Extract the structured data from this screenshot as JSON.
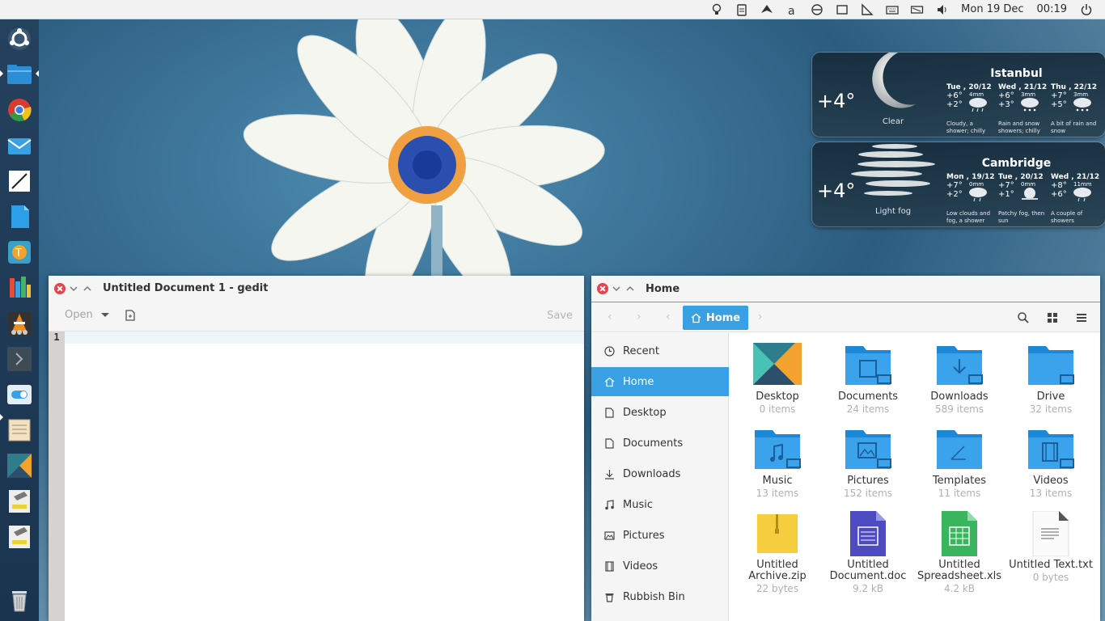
{
  "top_panel": {
    "date": "Mon 19 Dec",
    "time": "00:19",
    "icons": [
      "lightbulb-icon",
      "clipboard-icon",
      "bird-icon",
      "a-accent-icon",
      "no-entry-icon",
      "bracket-icon",
      "ruler-icon",
      "keyboard-icon",
      "battery-icon",
      "volume-icon",
      "power-icon"
    ]
  },
  "launcher": {
    "items": [
      "ubuntu-dash-icon",
      "files-icon",
      "chrome-icon",
      "mail-icon",
      "text-editor-icon",
      "document-icon",
      "tool-icon",
      "spreadsheet-app-icon",
      "vlc-icon",
      "terminal-icon",
      "toggle-app-icon",
      "notes-icon",
      "kde-icon",
      "installer-icon",
      "installer-2-icon",
      "trash-icon"
    ]
  },
  "weather": [
    {
      "temp": "+4°",
      "condition": "Clear",
      "city": "Istanbul",
      "days": [
        {
          "name": "Tue , 20/12",
          "hi": "+6°",
          "lo": "+2°",
          "mm": "4mm",
          "desc": "Cloudy, a shower; chilly"
        },
        {
          "name": "Wed , 21/12",
          "hi": "+6°",
          "lo": "+3°",
          "mm": "3mm",
          "desc": "Rain and snow showers; chilly"
        },
        {
          "name": "Thu , 22/12",
          "hi": "+7°",
          "lo": "+5°",
          "mm": "3mm",
          "desc": "A bit of rain and snow"
        }
      ]
    },
    {
      "temp": "+4°",
      "condition": "Light fog",
      "city": "Cambridge",
      "days": [
        {
          "name": "Mon , 19/12",
          "hi": "+7°",
          "lo": "+2°",
          "mm": "0mm",
          "desc": "Low clouds and fog, a shower"
        },
        {
          "name": "Tue , 20/12",
          "hi": "+7°",
          "lo": "+1°",
          "mm": "0mm",
          "desc": "Patchy fog, then sun"
        },
        {
          "name": "Wed , 21/12",
          "hi": "+8°",
          "lo": "+6°",
          "mm": "11mm",
          "desc": "A couple of showers"
        }
      ]
    }
  ],
  "gedit": {
    "title": "Untitled Document 1 - gedit",
    "open_label": "Open",
    "save_label": "Save",
    "line_number": "1"
  },
  "files": {
    "title": "Home",
    "path_label": "Home",
    "sidebar": [
      {
        "label": "Recent",
        "icon": "clock-icon"
      },
      {
        "label": "Home",
        "icon": "home-icon",
        "active": true
      },
      {
        "label": "Desktop",
        "icon": "desktop-icon"
      },
      {
        "label": "Documents",
        "icon": "document-icon"
      },
      {
        "label": "Downloads",
        "icon": "download-icon"
      },
      {
        "label": "Music",
        "icon": "music-icon"
      },
      {
        "label": "Pictures",
        "icon": "picture-icon"
      },
      {
        "label": "Videos",
        "icon": "video-icon"
      },
      {
        "label": "Rubbish Bin",
        "icon": "trash-icon"
      }
    ],
    "items": [
      {
        "name": "Desktop",
        "meta": "0 items",
        "icon": "desktop-folder-icon"
      },
      {
        "name": "Documents",
        "meta": "24 items",
        "icon": "documents-folder-icon"
      },
      {
        "name": "Downloads",
        "meta": "589 items",
        "icon": "downloads-folder-icon"
      },
      {
        "name": "Drive",
        "meta": "32 items",
        "icon": "drive-folder-icon"
      },
      {
        "name": "Music",
        "meta": "13 items",
        "icon": "music-folder-icon"
      },
      {
        "name": "Pictures",
        "meta": "152 items",
        "icon": "pictures-folder-icon"
      },
      {
        "name": "Templates",
        "meta": "11 items",
        "icon": "templates-folder-icon"
      },
      {
        "name": "Videos",
        "meta": "13 items",
        "icon": "videos-folder-icon"
      },
      {
        "name": "Untitled Archive.zip",
        "meta": "22 bytes",
        "icon": "archive-file-icon"
      },
      {
        "name": "Untitled Document.doc",
        "meta": "9.2 kB",
        "icon": "doc-file-icon"
      },
      {
        "name": "Untitled Spreadsheet.xls",
        "meta": "4.2 kB",
        "icon": "spreadsheet-file-icon"
      },
      {
        "name": "Untitled Text.txt",
        "meta": "0 bytes",
        "icon": "text-file-icon"
      }
    ]
  },
  "colors": {
    "accent": "#3aa0e4",
    "close": "#e8424a",
    "launcher": "#1e3954"
  }
}
